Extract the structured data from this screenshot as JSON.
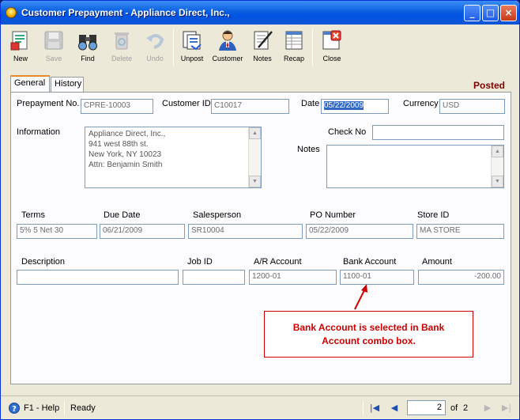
{
  "window": {
    "title": "Customer Prepayment - Appliance Direct, Inc.,",
    "minimize": "_",
    "maximize": "□",
    "close": "×"
  },
  "toolbar": {
    "items": [
      {
        "label": "New",
        "icon": "new-doc-icon",
        "enabled": true
      },
      {
        "label": "Save",
        "icon": "floppy-disk-icon",
        "enabled": false
      },
      {
        "label": "Find",
        "icon": "binoculars-icon",
        "enabled": true
      },
      {
        "label": "Delete",
        "icon": "recycle-bin-icon",
        "enabled": false
      },
      {
        "label": "Undo",
        "icon": "undo-arrow-icon",
        "enabled": false
      },
      {
        "label": "Unpost",
        "icon": "unpost-icon",
        "enabled": true
      },
      {
        "label": "Customer",
        "icon": "customer-person-icon",
        "enabled": true
      },
      {
        "label": "Notes",
        "icon": "notepad-icon",
        "enabled": true
      },
      {
        "label": "Recap",
        "icon": "recap-sheet-icon",
        "enabled": true
      },
      {
        "label": "Close",
        "icon": "close-window-icon",
        "enabled": true
      }
    ]
  },
  "tabs": [
    {
      "label": "General",
      "active": true
    },
    {
      "label": "History",
      "active": false
    }
  ],
  "status": "Posted",
  "form": {
    "prepayment_no_label": "Prepayment No.",
    "prepayment_no": "CPRE-10003",
    "customer_id_label": "Customer ID",
    "customer_id": "C10017",
    "date_label": "Date",
    "date": "05/22/2009",
    "currency_label": "Currency",
    "currency": "USD",
    "information_label": "Information",
    "information_lines": [
      "Appliance Direct, Inc.,",
      "941 west 88th st.",
      "New York, NY 10023",
      "Attn: Benjamin Smith"
    ],
    "check_no_label": "Check No",
    "check_no": "",
    "notes_label": "Notes",
    "notes": "",
    "terms_label": "Terms",
    "terms": "5% 5 Net 30",
    "due_date_label": "Due Date",
    "due_date": "06/21/2009",
    "salesperson_label": "Salesperson",
    "salesperson": "SR10004",
    "po_number_label": "PO Number",
    "po_number": "05/22/2009",
    "store_id_label": "Store ID",
    "store_id": "MA STORE",
    "description_label": "Description",
    "description": "",
    "job_id_label": "Job ID",
    "job_id": "",
    "ar_account_label": "A/R Account",
    "ar_account": "1200-01",
    "bank_account_label": "Bank Account",
    "bank_account": "1100-01",
    "amount_label": "Amount",
    "amount": "-200.00"
  },
  "callout": {
    "line1": "Bank Account is selected in Bank",
    "line2": "Account combo box.",
    "color": "#cc0000"
  },
  "statusbar": {
    "help": "F1 - Help",
    "state": "Ready",
    "page": "2",
    "of_label": "of",
    "total": "2"
  }
}
